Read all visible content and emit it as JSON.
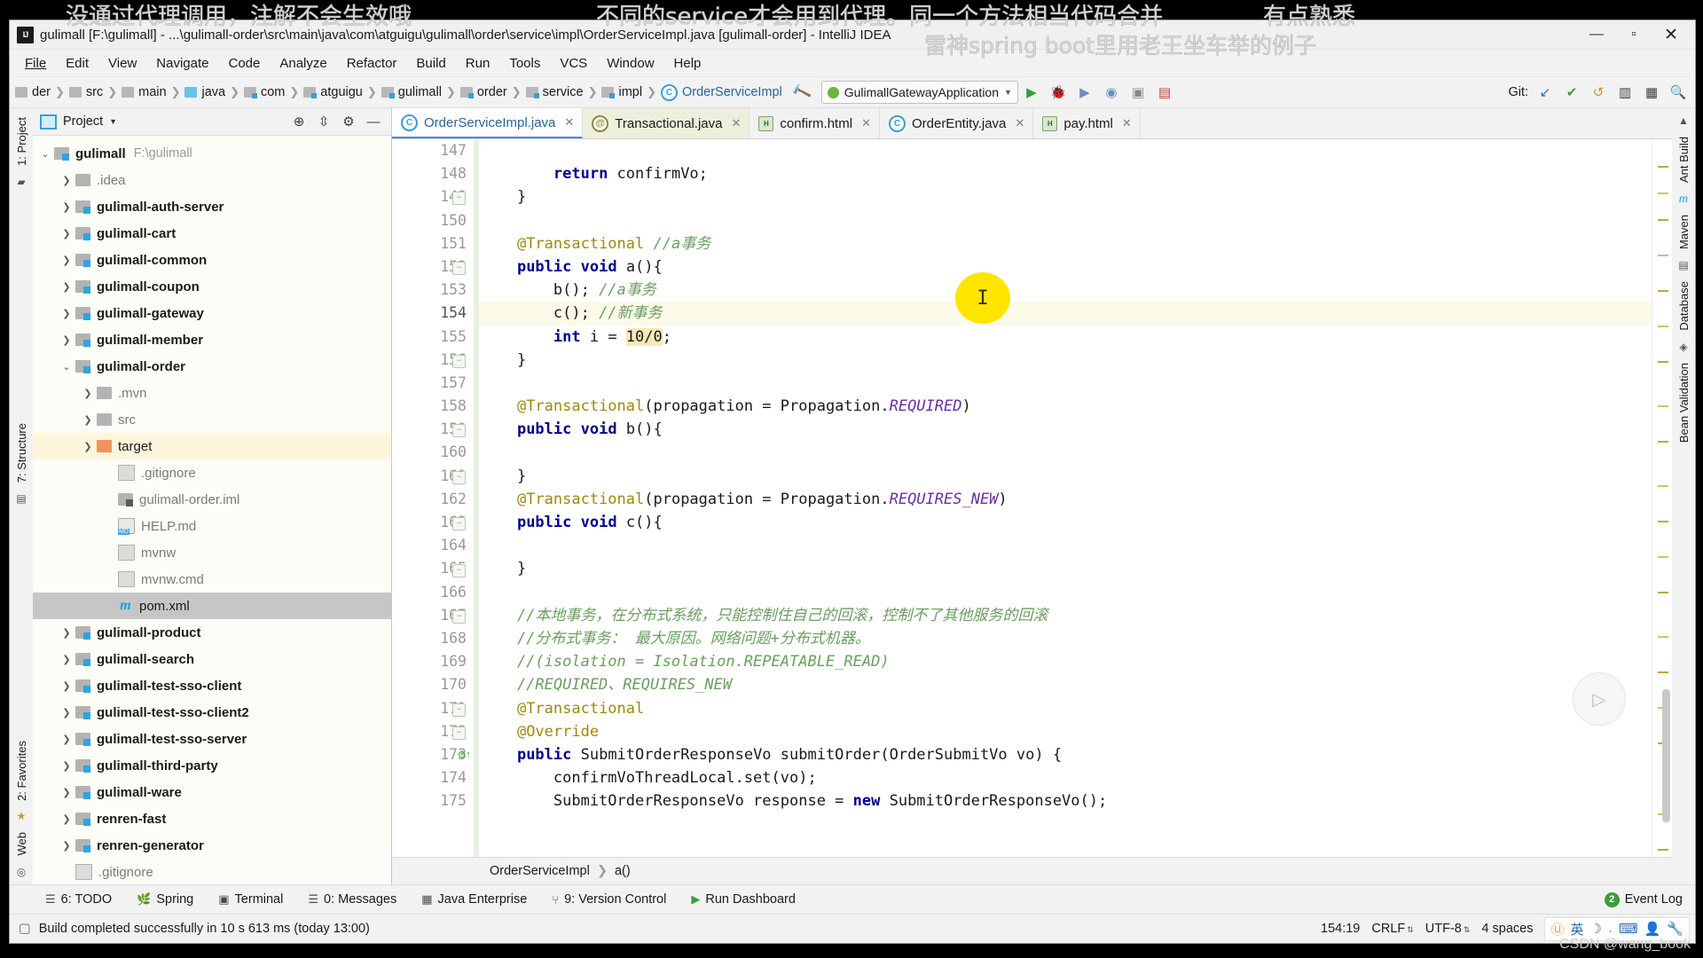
{
  "overlays": {
    "line1": "没通过代理调用，注解不会生效哦",
    "line2": "不同的service才会用到代理。同一个方法相当代码合并",
    "line3": "雷神spring boot里用老王坐车举的例子",
    "line4": "有点熟悉",
    "watermark": "CSDN @wang_book"
  },
  "titlebar": {
    "title": "gulimall [F:\\gulimall] - ...\\gulimall-order\\src\\main\\java\\com\\atguigu\\gulimall\\order\\service\\impl\\OrderServiceImpl.java [gulimall-order] - IntelliJ IDEA",
    "minimize": "—",
    "maximize": "▫",
    "close": "✕",
    "logo": "IJ"
  },
  "menubar": {
    "items": [
      "File",
      "Edit",
      "View",
      "Navigate",
      "Code",
      "Analyze",
      "Refactor",
      "Build",
      "Run",
      "Tools",
      "VCS",
      "Window",
      "Help"
    ]
  },
  "navbar": {
    "breadcrumbs": [
      {
        "label": "der",
        "icon": "folder-gray-icon"
      },
      {
        "label": "src",
        "icon": "folder-gray-icon"
      },
      {
        "label": "main",
        "icon": "folder-gray-icon"
      },
      {
        "label": "java",
        "icon": "folder-blue-icon"
      },
      {
        "label": "com",
        "icon": "folder-package-icon"
      },
      {
        "label": "atguigu",
        "icon": "folder-package-icon"
      },
      {
        "label": "gulimall",
        "icon": "folder-package-icon"
      },
      {
        "label": "order",
        "icon": "folder-package-icon"
      },
      {
        "label": "service",
        "icon": "folder-package-icon"
      },
      {
        "label": "impl",
        "icon": "folder-package-icon"
      },
      {
        "label": "OrderServiceImpl",
        "icon": "java-class-icon"
      }
    ],
    "run_config": "GulimallGatewayApplication",
    "git_label": "Git:",
    "icons": [
      "build-hammer-icon",
      "run-icon",
      "debug-icon",
      "coverage-icon",
      "profile-icon",
      "stop-icon",
      "attach-icon",
      "vcs-update-icon",
      "vcs-commit-icon",
      "vcs-rollback-icon",
      "layout-icon",
      "search-everywhere-icon"
    ]
  },
  "left_strip": {
    "top": "1: Project",
    "middle": "7: Structure",
    "bottom": "2: Favorites",
    "web": "Web"
  },
  "right_strip": {
    "items": [
      "Ant Build",
      "Maven",
      "Database",
      "Bean Validation"
    ]
  },
  "project_panel": {
    "header": "Project",
    "actions": [
      "locate-icon",
      "collapse-all-icon",
      "minimize-icon"
    ],
    "tree": [
      {
        "depth": 0,
        "arrow": "down",
        "icon": "module-icon",
        "label": "gulimall",
        "bold": true,
        "path": "F:\\gulimall"
      },
      {
        "depth": 1,
        "arrow": "right",
        "icon": "folder-icon",
        "label": ".idea",
        "dim": true
      },
      {
        "depth": 1,
        "arrow": "right",
        "icon": "module-icon",
        "label": "gulimall-auth-server",
        "bold": true
      },
      {
        "depth": 1,
        "arrow": "right",
        "icon": "module-icon",
        "label": "gulimall-cart",
        "bold": true
      },
      {
        "depth": 1,
        "arrow": "right",
        "icon": "module-icon",
        "label": "gulimall-common",
        "bold": true
      },
      {
        "depth": 1,
        "arrow": "right",
        "icon": "module-icon",
        "label": "gulimall-coupon",
        "bold": true
      },
      {
        "depth": 1,
        "arrow": "right",
        "icon": "module-icon",
        "label": "gulimall-gateway",
        "bold": true
      },
      {
        "depth": 1,
        "arrow": "right",
        "icon": "module-icon",
        "label": "gulimall-member",
        "bold": true
      },
      {
        "depth": 1,
        "arrow": "down",
        "icon": "module-icon",
        "label": "gulimall-order",
        "bold": true
      },
      {
        "depth": 2,
        "arrow": "right",
        "icon": "folder-icon",
        "label": ".mvn",
        "dim": true
      },
      {
        "depth": 2,
        "arrow": "right",
        "icon": "folder-icon",
        "label": "src",
        "dim": true
      },
      {
        "depth": 2,
        "arrow": "right",
        "icon": "folder-orange-icon",
        "label": "target",
        "highlight": true
      },
      {
        "depth": 3,
        "arrow": "none",
        "icon": "file-icon",
        "label": ".gitignore",
        "dim": true
      },
      {
        "depth": 3,
        "arrow": "none",
        "icon": "iml-icon",
        "label": "gulimall-order.iml",
        "dim": true
      },
      {
        "depth": 3,
        "arrow": "none",
        "icon": "markdown-icon",
        "label": "HELP.md",
        "dim": true
      },
      {
        "depth": 3,
        "arrow": "none",
        "icon": "file-icon",
        "label": "mvnw",
        "dim": true
      },
      {
        "depth": 3,
        "arrow": "none",
        "icon": "file-icon",
        "label": "mvnw.cmd",
        "dim": true
      },
      {
        "depth": 3,
        "arrow": "none",
        "icon": "maven-icon",
        "label": "pom.xml",
        "selected": true
      },
      {
        "depth": 1,
        "arrow": "right",
        "icon": "module-icon",
        "label": "gulimall-product",
        "bold": true
      },
      {
        "depth": 1,
        "arrow": "right",
        "icon": "module-icon",
        "label": "gulimall-search",
        "bold": true
      },
      {
        "depth": 1,
        "arrow": "right",
        "icon": "module-icon",
        "label": "gulimall-test-sso-client",
        "bold": true
      },
      {
        "depth": 1,
        "arrow": "right",
        "icon": "module-icon",
        "label": "gulimall-test-sso-client2",
        "bold": true
      },
      {
        "depth": 1,
        "arrow": "right",
        "icon": "module-icon",
        "label": "gulimall-test-sso-server",
        "bold": true
      },
      {
        "depth": 1,
        "arrow": "right",
        "icon": "module-icon",
        "label": "gulimall-third-party",
        "bold": true
      },
      {
        "depth": 1,
        "arrow": "right",
        "icon": "module-icon",
        "label": "gulimall-ware",
        "bold": true
      },
      {
        "depth": 1,
        "arrow": "right",
        "icon": "module-icon",
        "label": "renren-fast",
        "bold": true
      },
      {
        "depth": 1,
        "arrow": "right",
        "icon": "module-icon",
        "label": "renren-generator",
        "bold": true
      },
      {
        "depth": 1,
        "arrow": "none",
        "icon": "file-icon",
        "label": ".gitignore",
        "dim": true
      }
    ]
  },
  "editor": {
    "tabs": [
      {
        "label": "OrderServiceImpl.java",
        "icon": "java-class-icon",
        "active": true
      },
      {
        "label": "Transactional.java",
        "icon": "annotation-icon",
        "active": false
      },
      {
        "label": "confirm.html",
        "icon": "html-icon",
        "active": false
      },
      {
        "label": "OrderEntity.java",
        "icon": "java-class-icon",
        "active": false
      },
      {
        "label": "pay.html",
        "icon": "html-icon",
        "active": false
      }
    ],
    "first_line_number": 147,
    "current_line": 154,
    "lines": [
      {
        "n": 147,
        "text": ""
      },
      {
        "n": 148,
        "text": "        return confirmVo;"
      },
      {
        "n": 149,
        "text": "    }",
        "fold": true
      },
      {
        "n": 150,
        "text": ""
      },
      {
        "n": 151,
        "text": "    @Transactional //a事务"
      },
      {
        "n": 152,
        "text": "    public void a(){",
        "fold": true
      },
      {
        "n": 153,
        "text": "        b(); //a事务"
      },
      {
        "n": 154,
        "text": "        c(); //新事务"
      },
      {
        "n": 155,
        "text": "        int i = 10/0;"
      },
      {
        "n": 156,
        "text": "    }",
        "fold": true
      },
      {
        "n": 157,
        "text": ""
      },
      {
        "n": 158,
        "text": "    @Transactional(propagation = Propagation.REQUIRED)"
      },
      {
        "n": 159,
        "text": "    public void b(){",
        "fold": true
      },
      {
        "n": 160,
        "text": ""
      },
      {
        "n": 161,
        "text": "    }",
        "fold": true
      },
      {
        "n": 162,
        "text": "    @Transactional(propagation = Propagation.REQUIRES_NEW)"
      },
      {
        "n": 163,
        "text": "    public void c(){",
        "fold": true
      },
      {
        "n": 164,
        "text": ""
      },
      {
        "n": 165,
        "text": "    }",
        "fold": true
      },
      {
        "n": 166,
        "text": ""
      },
      {
        "n": 167,
        "text": "    //本地事务，在分布式系统，只能控制住自己的回滚，控制不了其他服务的回滚",
        "fold": true
      },
      {
        "n": 168,
        "text": "    //分布式事务： 最大原因。网络问题+分布式机器。"
      },
      {
        "n": 169,
        "text": "    //(isolation = Isolation.REPEATABLE_READ)"
      },
      {
        "n": 170,
        "text": "    //REQUIRED、REQUIRES_NEW"
      },
      {
        "n": 171,
        "text": "    @Transactional",
        "fold": true
      },
      {
        "n": 172,
        "text": "    @Override",
        "fold": true
      },
      {
        "n": 173,
        "text": "    public SubmitOrderResponseVo submitOrder(OrderSubmitVo vo) {",
        "gutter_mark": true
      },
      {
        "n": 174,
        "text": "        confirmVoThreadLocal.set(vo);"
      },
      {
        "n": 175,
        "text": "        SubmitOrderResponseVo response = new SubmitOrderResponseVo();"
      }
    ],
    "breadcrumb": [
      "OrderServiceImpl",
      "a()"
    ]
  },
  "bottom_toolwindows": [
    {
      "label": "6: TODO",
      "icon": "todo-icon"
    },
    {
      "label": "Spring",
      "icon": "spring-leaf-icon"
    },
    {
      "label": "Terminal",
      "icon": "terminal-icon"
    },
    {
      "label": "0: Messages",
      "icon": "messages-icon"
    },
    {
      "label": "Java Enterprise",
      "icon": "java-enterprise-icon"
    },
    {
      "label": "9: Version Control",
      "icon": "version-control-icon"
    },
    {
      "label": "Run Dashboard",
      "icon": "run-dashboard-icon"
    }
  ],
  "event_log": {
    "label": "Event Log",
    "badge": "2"
  },
  "statusbar": {
    "message": "Build completed successfully in 10 s 613 ms (today 13:00)",
    "caret": "154:19",
    "line_separator": "CRLF",
    "encoding": "UTF-8",
    "indent": "4 spaces",
    "tray": [
      "ime-icon",
      "ime-cn",
      "moon-icon",
      "punct-icon",
      "keyboard-icon",
      "user-icon",
      "wrench-icon"
    ]
  }
}
